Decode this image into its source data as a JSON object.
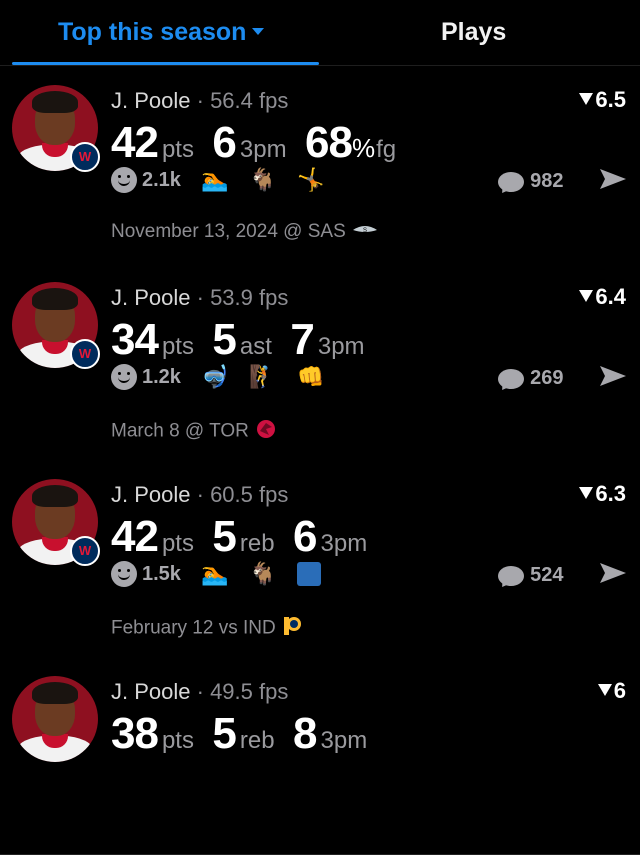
{
  "tabs": {
    "top_season": "Top this season",
    "plays": "Plays"
  },
  "cards": [
    {
      "player": "J. Poole",
      "sep": " · ",
      "fps": "56.4 fps",
      "score": "6.5",
      "stats": [
        {
          "value": "42",
          "label": "pts"
        },
        {
          "value": "6",
          "label": "3pm"
        },
        {
          "value": "68",
          "label": "fg",
          "pct": "%"
        }
      ],
      "reactions": "2.1k",
      "comments": "982",
      "date": "November 13, 2024 @ SAS",
      "opponent_icon": "spurs-logo-icon"
    },
    {
      "player": "J. Poole",
      "sep": " · ",
      "fps": "53.9 fps",
      "score": "6.4",
      "stats": [
        {
          "value": "34",
          "label": "pts"
        },
        {
          "value": "5",
          "label": "ast"
        },
        {
          "value": "7",
          "label": "3pm"
        }
      ],
      "reactions": "1.2k",
      "comments": "269",
      "date": "March 8 @ TOR",
      "opponent_icon": "raptors-logo-icon"
    },
    {
      "player": "J. Poole",
      "sep": " · ",
      "fps": "60.5 fps",
      "score": "6.3",
      "stats": [
        {
          "value": "42",
          "label": "pts"
        },
        {
          "value": "5",
          "label": "reb"
        },
        {
          "value": "6",
          "label": "3pm"
        }
      ],
      "reactions": "1.5k",
      "comments": "524",
      "date": "February 12 vs IND",
      "opponent_icon": "pacers-logo-icon"
    },
    {
      "player": "J. Poole",
      "sep": " · ",
      "fps": "49.5 fps",
      "score": "6",
      "stats": [
        {
          "value": "38",
          "label": "pts"
        },
        {
          "value": "5",
          "label": "reb"
        },
        {
          "value": "8",
          "label": "3pm"
        }
      ]
    }
  ],
  "colors": {
    "accent": "#1d8cf0",
    "muted": "#8e8e93",
    "background": "#000000"
  }
}
